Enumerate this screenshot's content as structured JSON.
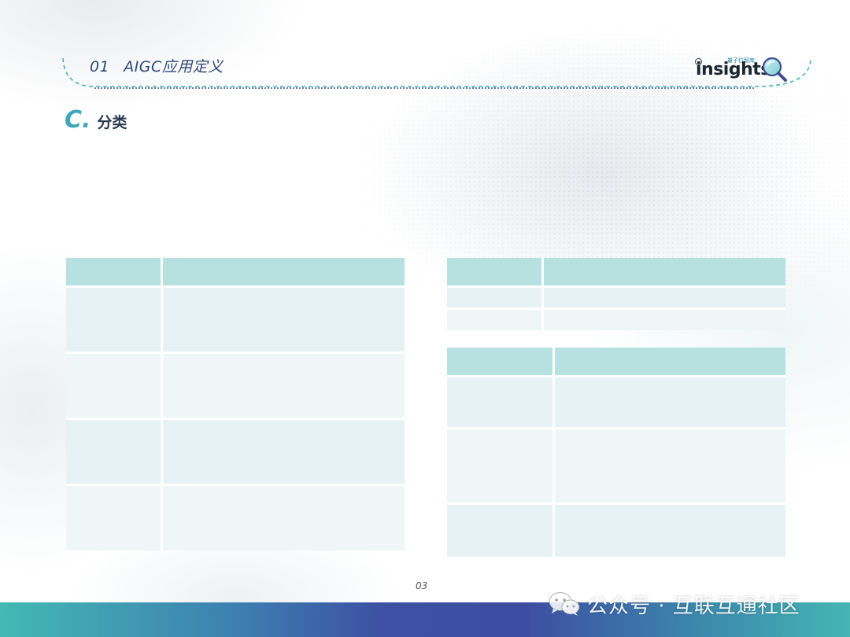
{
  "header": {
    "section_number": "01",
    "section_title": "AIGC应用定义",
    "logo": {
      "wordmark": "insights",
      "tagline": "量子位智库",
      "icon": "magnifier-icon"
    }
  },
  "subsection": {
    "letter": "C.",
    "title": "分类"
  },
  "tables": {
    "left": {
      "header": [
        "",
        ""
      ],
      "rows": [
        [
          "",
          ""
        ],
        [
          "",
          ""
        ],
        [
          "",
          ""
        ],
        [
          "",
          ""
        ]
      ]
    },
    "right_top": {
      "header": [
        "",
        ""
      ],
      "rows": [
        [
          "",
          ""
        ],
        [
          "",
          ""
        ]
      ]
    },
    "right_bottom": {
      "header": [
        "",
        ""
      ],
      "rows": [
        [
          "",
          ""
        ],
        [
          "",
          ""
        ],
        [
          "",
          ""
        ]
      ]
    }
  },
  "footer": {
    "page_number": "03",
    "watermark_text": "公众号 · 互联互通社区",
    "watermark_icon": "wechat-icon"
  },
  "colors": {
    "accent_teal": "#3ea7b9",
    "table_header": "#b7e0e1",
    "table_row": "#e6f2f3",
    "heading_blue": "#2f4a78"
  }
}
